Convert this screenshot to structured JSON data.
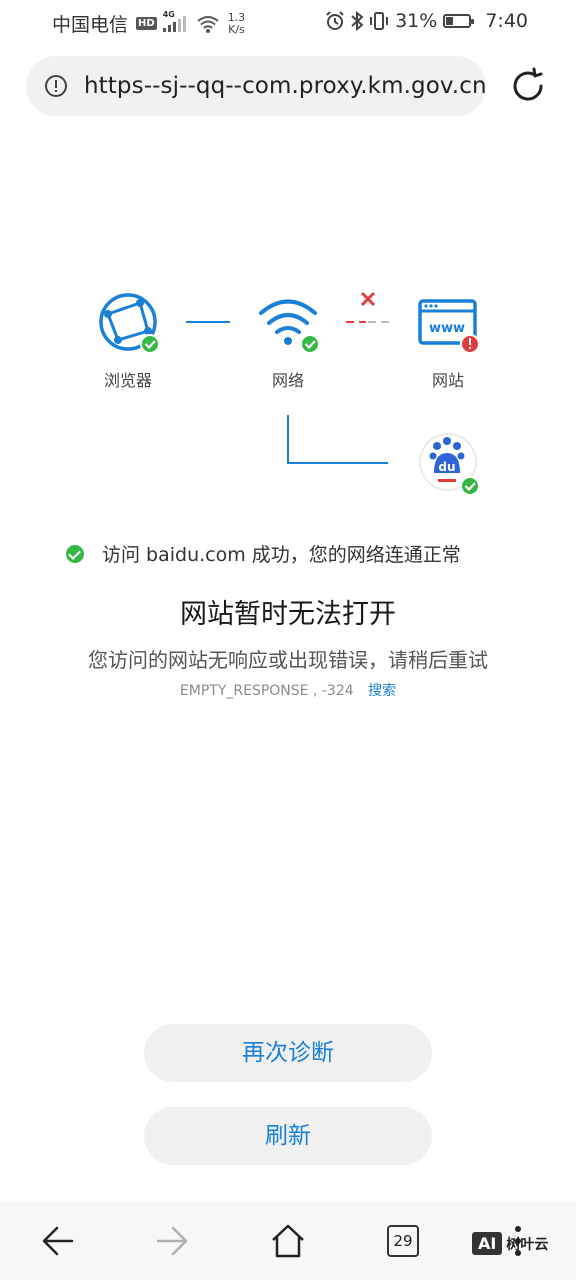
{
  "status_bar": {
    "carrier": "中国电信",
    "hd": "HD",
    "network_type": "4G",
    "speed_value": "1.3",
    "speed_unit": "K/s",
    "battery": "31%",
    "time": "7:40"
  },
  "address_bar": {
    "url": "https--sj--qq--com.proxy.km.gov.cn"
  },
  "diagnosis": {
    "browser_label": "浏览器",
    "network_label": "网络",
    "website_label": "网站",
    "www_text": "www",
    "baidu_text": "du"
  },
  "error_page": {
    "success_message": "访问 baidu.com 成功，您的网络连通正常",
    "title": "网站暂时无法打开",
    "subtitle": "您访问的网站无响应或出现错误，请稍后重试",
    "error_code": "EMPTY_RESPONSE , -324",
    "search_link": "搜索",
    "rediagnose_button": "再次诊断",
    "refresh_button": "刷新"
  },
  "bottom_nav": {
    "tab_count": "29"
  },
  "watermark": {
    "badge": "AI",
    "text": "树叶云"
  },
  "colors": {
    "accent_blue": "#1a7fd6",
    "success_green": "#35b843",
    "error_red": "#e03c3c"
  }
}
